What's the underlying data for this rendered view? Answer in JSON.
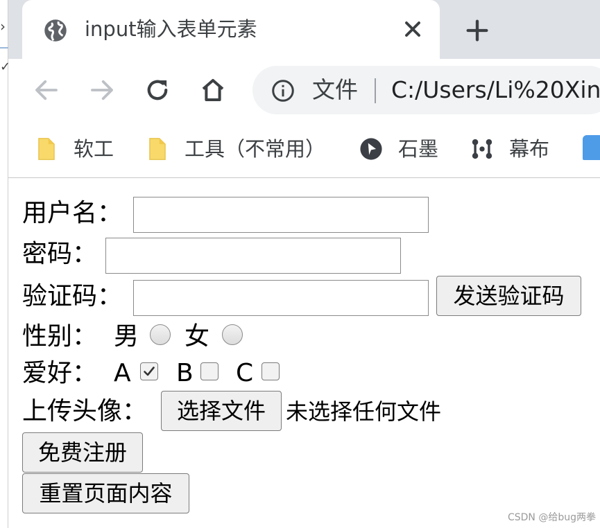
{
  "browser": {
    "tab_title": "input输入表单元素",
    "address": {
      "scheme_label": "文件",
      "url": "C:/Users/Li%20Xin"
    },
    "bookmarks": [
      {
        "label": "软工",
        "icon": "folder-icon"
      },
      {
        "label": "工具（不常用）",
        "icon": "folder-icon"
      },
      {
        "label": "石墨",
        "icon": "shimo-icon"
      },
      {
        "label": "幕布",
        "icon": "mubu-icon"
      }
    ],
    "colors": {
      "tabstrip": "#dee1e6",
      "omnibox": "#f1f3f4",
      "folder": "#f8d96a",
      "bookmark_blue": "#4e9be8"
    }
  },
  "form": {
    "username_label": "用户名：",
    "password_label": "密码：",
    "captcha_label": "验证码：",
    "send_code_button": "发送验证码",
    "gender_label": "性别：",
    "gender_options": [
      {
        "label": "男",
        "checked": false
      },
      {
        "label": "女",
        "checked": false
      }
    ],
    "hobby_label": "爱好：",
    "hobby_options": [
      {
        "label": "A",
        "checked": true
      },
      {
        "label": "B",
        "checked": false
      },
      {
        "label": "C",
        "checked": false
      }
    ],
    "avatar_label": "上传头像：",
    "choose_file_button": "选择文件",
    "no_file_text": "未选择任何文件",
    "register_button": "免费注册",
    "reset_button": "重置页面内容"
  },
  "watermark": "CSDN @给bug两拳"
}
